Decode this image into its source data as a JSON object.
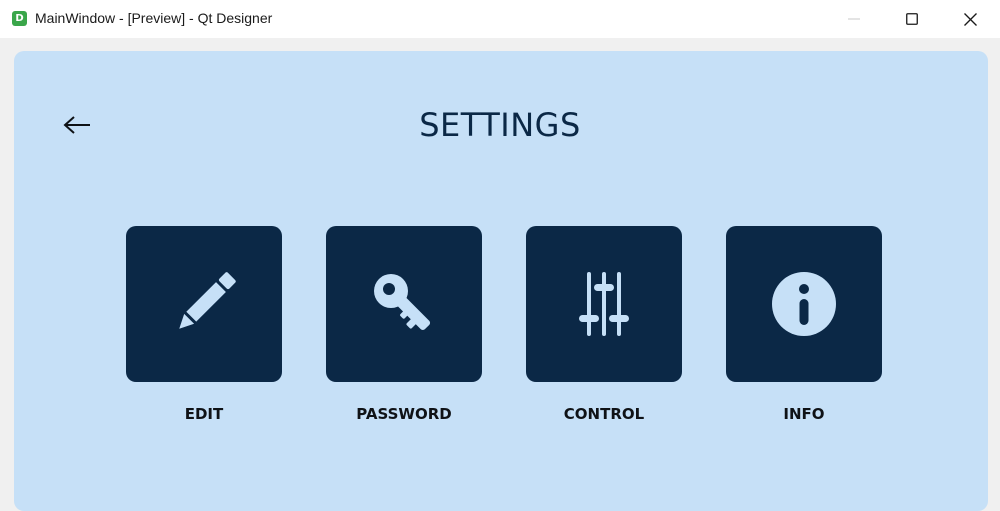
{
  "window": {
    "title": "MainWindow - [Preview] - Qt Designer",
    "app_icon_letter": "D"
  },
  "page": {
    "title": "SETTINGS"
  },
  "tiles": [
    {
      "label": "EDIT",
      "icon": "pencil-icon"
    },
    {
      "label": "PASSWORD",
      "icon": "key-icon"
    },
    {
      "label": "CONTROL",
      "icon": "sliders-icon"
    },
    {
      "label": "INFO",
      "icon": "info-icon"
    }
  ],
  "colors": {
    "panel_bg": "#c6e0f7",
    "tile_bg": "#0b2846",
    "icon_fg": "#c6e0f7",
    "title_fg": "#0b2846"
  }
}
